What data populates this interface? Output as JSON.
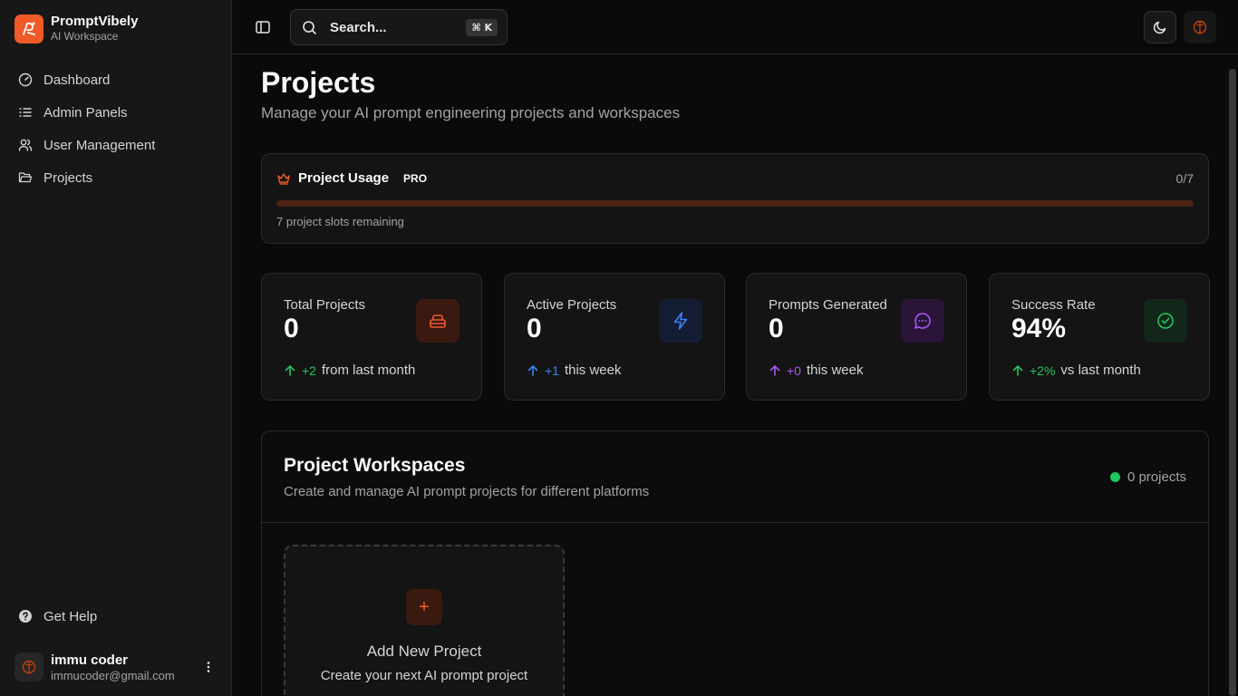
{
  "brand": {
    "name": "PromptVibely",
    "subtitle": "AI Workspace"
  },
  "sidebar": {
    "items": [
      {
        "label": "Dashboard",
        "icon": "gauge-icon"
      },
      {
        "label": "Admin Panels",
        "icon": "list-icon"
      },
      {
        "label": "User Management",
        "icon": "users-icon"
      },
      {
        "label": "Projects",
        "icon": "folder-icon"
      }
    ],
    "help": "Get Help",
    "user": {
      "name": "immu coder",
      "email": "immucoder@gmail.com"
    }
  },
  "header": {
    "search_placeholder": "Search...",
    "search_shortcut": "⌘ K"
  },
  "page": {
    "title": "Projects",
    "subtitle": "Manage your AI prompt engineering projects and workspaces"
  },
  "usage": {
    "title": "Project Usage",
    "badge": "PRO",
    "count": "0/7",
    "used_fraction": 0,
    "note": "7 project slots remaining"
  },
  "stats": [
    {
      "label": "Total Projects",
      "value": "0",
      "delta": "+2",
      "suffix": "from last month",
      "color": "#22c55e",
      "icon": "box-icon"
    },
    {
      "label": "Active Projects",
      "value": "0",
      "delta": "+1",
      "suffix": "this week",
      "color": "#3b82f6",
      "icon": "lightning-icon"
    },
    {
      "label": "Prompts Generated",
      "value": "0",
      "delta": "+0",
      "suffix": "this week",
      "color": "#a855f7",
      "icon": "chat-icon"
    },
    {
      "label": "Success Rate",
      "value": "94%",
      "delta": "+2%",
      "suffix": "vs last month",
      "color": "#22c55e",
      "icon": "check-circle-icon"
    }
  ],
  "workspaces": {
    "title": "Project Workspaces",
    "subtitle": "Create and manage AI prompt projects for different platforms",
    "count": "0 projects",
    "add_title": "Add New Project",
    "add_subtitle": "Create your next AI prompt project"
  },
  "colors": {
    "accent": "#f05a28",
    "background": "#0a0a0a",
    "sidebar": "#171717"
  }
}
